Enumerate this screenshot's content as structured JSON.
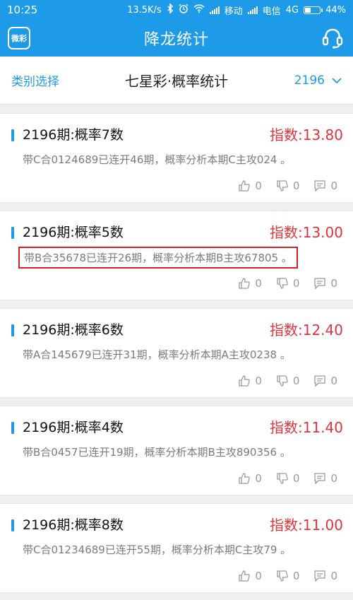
{
  "status_bar": {
    "time": "10:25",
    "net_speed": "13.5K/s",
    "carrier1": "移动",
    "carrier2": "电信",
    "network_type": "4G",
    "battery": "44%",
    "battery_level": 0.44
  },
  "header": {
    "logo_text": "微彩",
    "title": "降龙统计"
  },
  "category": {
    "select_label": "类别选择",
    "title": "七星彩·概率统计",
    "period": "2196"
  },
  "items": [
    {
      "title": "2196期:概率7数",
      "index": "指数:13.80",
      "desc": "带C合0124689已连开46期，概率分析本期C主攻024 。",
      "likes": "0",
      "dislikes": "0",
      "comments": "0"
    },
    {
      "title": "2196期:概率5数",
      "index": "指数:13.00",
      "desc": "带B合35678已连开26期，概率分析本期B主攻67805 。",
      "likes": "0",
      "dislikes": "0",
      "comments": "0"
    },
    {
      "title": "2196期:概率6数",
      "index": "指数:12.40",
      "desc": "带A合145679已连开31期，概率分析本期A主攻0238 。",
      "likes": "0",
      "dislikes": "0",
      "comments": "0"
    },
    {
      "title": "2196期:概率4数",
      "index": "指数:11.40",
      "desc": "带B合0457已连开19期，概率分析本期B主攻890356 。",
      "likes": "0",
      "dislikes": "0",
      "comments": "0"
    },
    {
      "title": "2196期:概率8数",
      "index": "指数:11.00",
      "desc": "带C合01234689已连开55期，概率分析本期C主攻79 。",
      "likes": "0",
      "dislikes": "0",
      "comments": "0"
    }
  ],
  "colors": {
    "brand": "#1e9be8",
    "index_red": "#e0333b",
    "highlight_border": "#d2202a"
  }
}
